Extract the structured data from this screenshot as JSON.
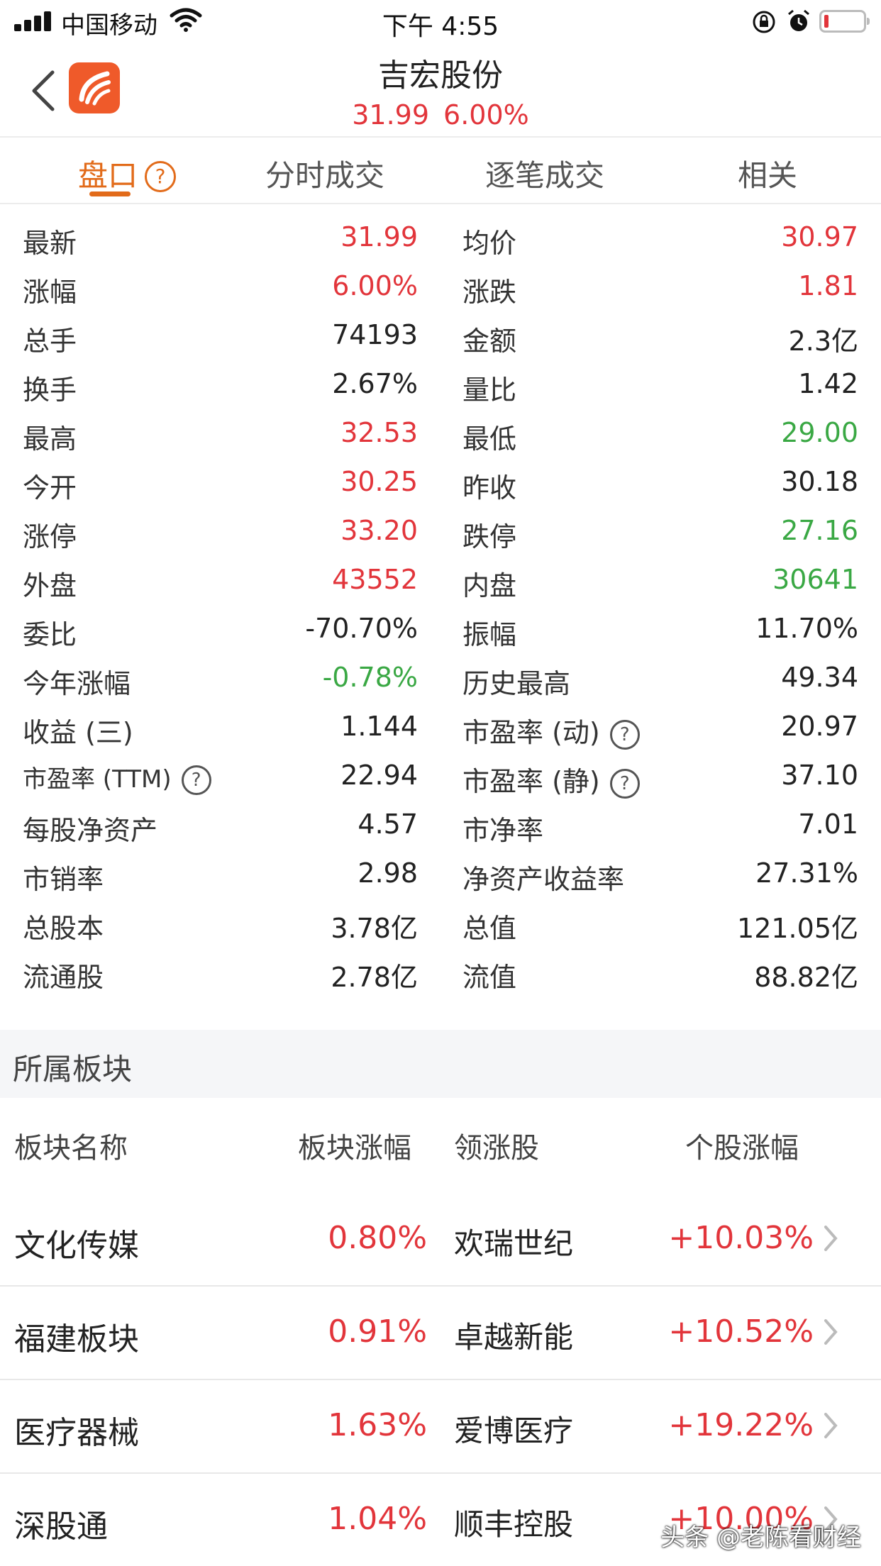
{
  "status_bar": {
    "carrier": "中国移动",
    "time": "下午 4:55"
  },
  "header": {
    "title": "吉宏股份",
    "price": "31.99",
    "change_pct": "6.00%"
  },
  "tabs": [
    {
      "label": "盘口"
    },
    {
      "label": "分时成交"
    },
    {
      "label": "逐笔成交"
    },
    {
      "label": "相关"
    }
  ],
  "question_mark": "?",
  "stats": [
    {
      "l": "最新",
      "lv": "31.99",
      "r": "均价",
      "rv": "30.97"
    },
    {
      "l": "涨幅",
      "lv": "6.00%",
      "r": "涨跌",
      "rv": "1.81"
    },
    {
      "l": "总手",
      "lv": "74193",
      "r": "金额",
      "rv": "2.3亿"
    },
    {
      "l": "换手",
      "lv": "2.67%",
      "r": "量比",
      "rv": "1.42"
    },
    {
      "l": "最高",
      "lv": "32.53",
      "r": "最低",
      "rv": "29.00"
    },
    {
      "l": "今开",
      "lv": "30.25",
      "r": "昨收",
      "rv": "30.18"
    },
    {
      "l": "涨停",
      "lv": "33.20",
      "r": "跌停",
      "rv": "27.16"
    },
    {
      "l": "外盘",
      "lv": "43552",
      "r": "内盘",
      "rv": "30641"
    },
    {
      "l": "委比",
      "lv": "-70.70%",
      "r": "振幅",
      "rv": "11.70%"
    },
    {
      "l": "今年涨幅",
      "lv": "-0.78%",
      "r": "历史最高",
      "rv": "49.34"
    },
    {
      "l": "收益 (三)",
      "lv": "1.144",
      "r": "市盈率 (动)",
      "rv": "20.97"
    },
    {
      "l": "市盈率 (TTM)",
      "lv": "22.94",
      "r": "市盈率 (静)",
      "rv": "37.10"
    },
    {
      "l": "每股净资产",
      "lv": "4.57",
      "r": "市净率",
      "rv": "7.01"
    },
    {
      "l": "市销率",
      "lv": "2.98",
      "r": "净资产收益率",
      "rv": "27.31%"
    },
    {
      "l": "总股本",
      "lv": "3.78亿",
      "r": "总值",
      "rv": "121.05亿"
    },
    {
      "l": "流通股",
      "lv": "2.78亿",
      "r": "流值",
      "rv": "88.82亿"
    }
  ],
  "colors": {
    "up": "#e2353b",
    "down": "#3aa844",
    "accent": "#e26b1a"
  },
  "sector": {
    "title": "所属板块",
    "headers": {
      "name": "板块名称",
      "pct": "板块涨幅",
      "leader": "领涨股",
      "leader_pct": "个股涨幅"
    },
    "rows": [
      {
        "name": "文化传媒",
        "pct": "0.80%",
        "leader": "欢瑞世纪",
        "leader_pct": "+10.03%"
      },
      {
        "name": "福建板块",
        "pct": "0.91%",
        "leader": "卓越新能",
        "leader_pct": "+10.52%"
      },
      {
        "name": "医疗器械",
        "pct": "1.63%",
        "leader": "爱博医疗",
        "leader_pct": "+19.22%"
      },
      {
        "name": "深股通",
        "pct": "1.04%",
        "leader": "顺丰控股",
        "leader_pct": "+10.00%"
      }
    ]
  },
  "watermark": "头条 @老陈看财经"
}
